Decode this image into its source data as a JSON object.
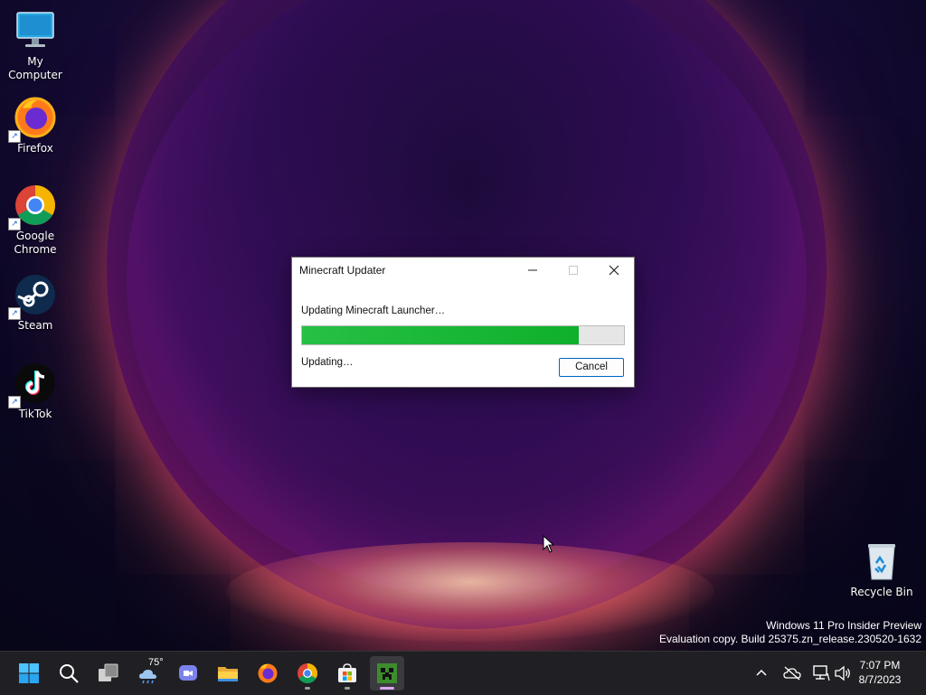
{
  "desktop": {
    "icons": [
      {
        "label": "My Computer",
        "icon": "monitor-icon"
      },
      {
        "label": "Firefox",
        "icon": "firefox-icon"
      },
      {
        "label": "Google Chrome",
        "icon": "chrome-icon"
      },
      {
        "label": "Steam",
        "icon": "steam-icon"
      },
      {
        "label": "TikTok",
        "icon": "tiktok-icon"
      },
      {
        "label": "Recycle Bin",
        "icon": "recycle-bin-icon"
      }
    ],
    "watermark": {
      "line1": "Windows 11 Pro Insider Preview",
      "line2": "Evaluation copy. Build 25375.zn_release.230520-1632"
    }
  },
  "dialog": {
    "title": "Minecraft Updater",
    "status_main": "Updating Minecraft Launcher…",
    "status_sub": "Updating…",
    "cancel_label": "Cancel",
    "progress_fraction": 0.86,
    "progress_color": "#13b32f",
    "caption_buttons": {
      "minimize": "minimize-icon",
      "maximize": "maximize-icon",
      "close": "close-icon"
    }
  },
  "taskbar": {
    "weather_temp": "75°",
    "apps": [
      "start-icon",
      "search-icon",
      "task-view-icon",
      "weather-icon",
      "teams-chat-icon",
      "file-explorer-icon",
      "firefox-icon",
      "chrome-icon",
      "microsoft-store-icon",
      "minecraft-icon"
    ],
    "tray": [
      "chevron-up-icon",
      "cloud-off-icon",
      "network-icon",
      "volume-icon"
    ],
    "clock": {
      "time": "7:07 PM",
      "date": "8/7/2023"
    }
  }
}
